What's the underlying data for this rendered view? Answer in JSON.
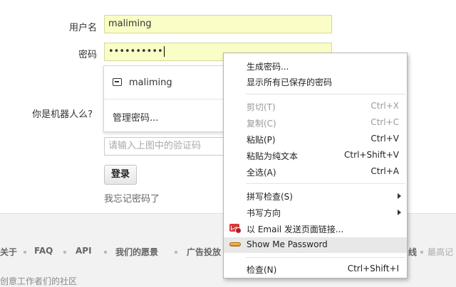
{
  "form": {
    "username_label": "用户名",
    "username_value": "maliming",
    "password_label": "密码",
    "password_value": "••••••••••",
    "captcha_label": "你是机器人么?",
    "captcha_placeholder": "请输入上图中的验证码",
    "login_button": "登录",
    "forgot_link": "我忘记密码了"
  },
  "password_suggestions": {
    "saved_username": "maliming",
    "manage": "管理密码..."
  },
  "context_menu": {
    "generate_password": "生成密码...",
    "show_saved_passwords": "显示所有已保存的密码",
    "cut": {
      "label": "剪切(T)",
      "shortcut": "Ctrl+X"
    },
    "copy": {
      "label": "复制(C)",
      "shortcut": "Ctrl+C"
    },
    "paste": {
      "label": "粘贴(P)",
      "shortcut": "Ctrl+V"
    },
    "paste_plain": {
      "label": "粘贴为纯文本",
      "shortcut": "Ctrl+Shift+V"
    },
    "select_all": {
      "label": "全选(A)",
      "shortcut": "Ctrl+A"
    },
    "spellcheck": "拼写检查(S)",
    "writing_direction": "书写方向",
    "email_link": "以 Email 发送页面链接...",
    "show_me_password": "Show Me Password",
    "inspect": {
      "label": "检查(N)",
      "shortcut": "Ctrl+Shift+I"
    }
  },
  "footer": {
    "nav": [
      "关于",
      "FAQ",
      "API",
      "我们的愿景",
      "广告投放",
      "线",
      "最高记"
    ],
    "tagline": "创意工作者们的社区"
  },
  "colors": {
    "autofill_bg": "#fafdc5",
    "menu_highlight": "#e8e8e8",
    "mail_icon": "#d63a3a"
  }
}
